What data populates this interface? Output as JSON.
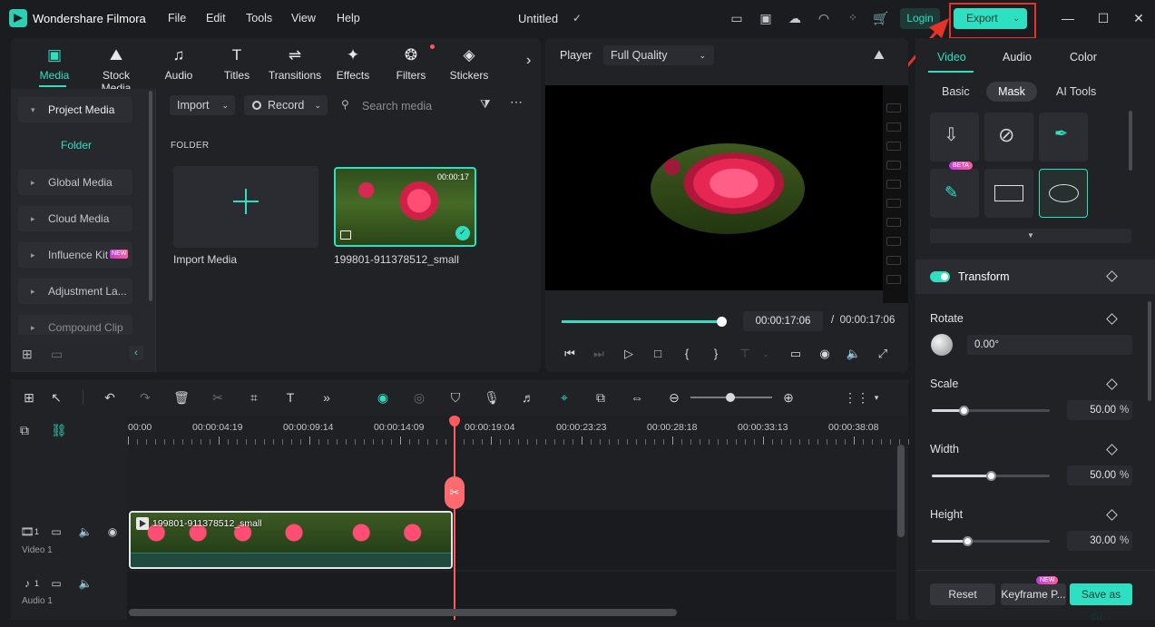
{
  "app": {
    "name": "Wondershare Filmora",
    "document_title": "Untitled",
    "menu": [
      "File",
      "Edit",
      "Tools",
      "View",
      "Help"
    ],
    "login_label": "Login",
    "export_label": "Export"
  },
  "media_panel": {
    "tabs": [
      {
        "label": "Media",
        "icon": "media-icon",
        "active": true
      },
      {
        "label": "Stock Media",
        "icon": "stock-media-icon"
      },
      {
        "label": "Audio",
        "icon": "music-note-icon"
      },
      {
        "label": "Titles",
        "icon": "titles-icon"
      },
      {
        "label": "Transitions",
        "icon": "transitions-icon"
      },
      {
        "label": "Effects",
        "icon": "effects-icon"
      },
      {
        "label": "Filters",
        "icon": "filters-icon"
      },
      {
        "label": "Stickers",
        "icon": "stickers-icon"
      }
    ],
    "sidebar": {
      "project_media": "Project Media",
      "folder": "Folder",
      "items": [
        "Global Media",
        "Cloud Media",
        "Influence Kit",
        "Adjustment La...",
        "Compound Clip"
      ],
      "new_badge": "NEW"
    },
    "toolbar": {
      "import_label": "Import",
      "record_label": "Record",
      "search_placeholder": "Search media"
    },
    "folder_heading": "FOLDER",
    "import_media_label": "Import Media",
    "clip": {
      "duration": "00:00:17",
      "name": "199801-911378512_small"
    }
  },
  "player": {
    "label": "Player",
    "quality": "Full Quality",
    "current_time": "00:00:17:06",
    "separator": "/",
    "total_time": "00:00:17:06",
    "progress": 1.0
  },
  "properties": {
    "tabs": [
      "Video",
      "Audio",
      "Color"
    ],
    "subtabs": [
      "Basic",
      "Mask",
      "AI Tools"
    ],
    "beta_badge": "BETA",
    "transform_label": "Transform",
    "rotate": {
      "label": "Rotate",
      "value": "0.00°"
    },
    "scale": {
      "label": "Scale",
      "value": "50.00",
      "unit": "%",
      "level": 0.27
    },
    "width": {
      "label": "Width",
      "value": "50.00",
      "unit": "%",
      "level": 0.5
    },
    "height": {
      "label": "Height",
      "value": "30.00",
      "unit": "%",
      "level": 0.3
    },
    "buttons": {
      "reset": "Reset",
      "keyframe": "Keyframe P...",
      "save": "Save as cu...",
      "new_badge": "NEW"
    }
  },
  "timeline": {
    "ruler": [
      "00:00",
      "00:00:04:19",
      "00:00:09:14",
      "00:00:14:09",
      "00:00:19:04",
      "00:00:23:23",
      "00:00:28:18",
      "00:00:33:13",
      "00:00:38:08"
    ],
    "video_track_label": "Video 1",
    "video_track_number": "1",
    "audio_track_label": "Audio 1",
    "audio_track_number": "1",
    "clip_name": "199801-911378512_small"
  },
  "colors": {
    "accent": "#2de0c2",
    "highlight": "#e5332a",
    "playhead": "#ff5a5f"
  }
}
